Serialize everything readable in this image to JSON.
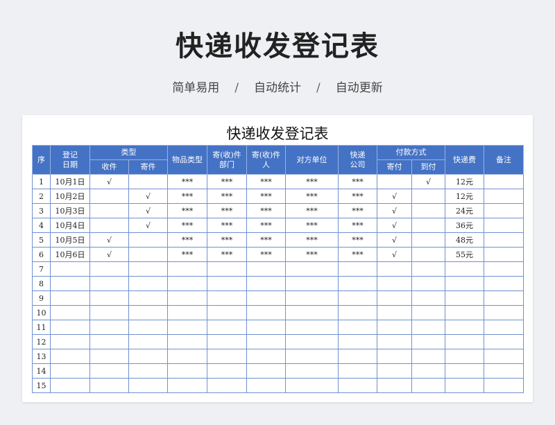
{
  "header": {
    "title": "快递收发登记表",
    "subtitle_items": [
      "简单易用",
      "自动统计",
      "自动更新"
    ],
    "separator": "/"
  },
  "sheet": {
    "title": "快递收发登记表",
    "columns": {
      "seq": "序",
      "date": "登记日期",
      "type_group": "类型",
      "receive": "收件",
      "send": "寄件",
      "item_type": "物品类型",
      "dept": "寄(收)件部门",
      "person": "寄(收)件人",
      "counterparty": "对方单位",
      "courier": "快递公司",
      "pay_group": "付款方式",
      "pay_send": "寄付",
      "pay_collect": "到付",
      "fee": "快递费",
      "note": "备注"
    },
    "rows": [
      {
        "seq": "1",
        "date": "10月1日",
        "receive": "√",
        "send": "",
        "item_type": "***",
        "dept": "***",
        "person": "***",
        "counterparty": "***",
        "courier": "***",
        "pay_send": "",
        "pay_collect": "√",
        "fee": "12元",
        "note": ""
      },
      {
        "seq": "2",
        "date": "10月2日",
        "receive": "",
        "send": "√",
        "item_type": "***",
        "dept": "***",
        "person": "***",
        "counterparty": "***",
        "courier": "***",
        "pay_send": "√",
        "pay_collect": "",
        "fee": "12元",
        "note": ""
      },
      {
        "seq": "3",
        "date": "10月3日",
        "receive": "",
        "send": "√",
        "item_type": "***",
        "dept": "***",
        "person": "***",
        "counterparty": "***",
        "courier": "***",
        "pay_send": "√",
        "pay_collect": "",
        "fee": "24元",
        "note": ""
      },
      {
        "seq": "4",
        "date": "10月4日",
        "receive": "",
        "send": "√",
        "item_type": "***",
        "dept": "***",
        "person": "***",
        "counterparty": "***",
        "courier": "***",
        "pay_send": "√",
        "pay_collect": "",
        "fee": "36元",
        "note": ""
      },
      {
        "seq": "5",
        "date": "10月5日",
        "receive": "√",
        "send": "",
        "item_type": "***",
        "dept": "***",
        "person": "***",
        "counterparty": "***",
        "courier": "***",
        "pay_send": "√",
        "pay_collect": "",
        "fee": "48元",
        "note": ""
      },
      {
        "seq": "6",
        "date": "10月6日",
        "receive": "√",
        "send": "",
        "item_type": "***",
        "dept": "***",
        "person": "***",
        "counterparty": "***",
        "courier": "***",
        "pay_send": "√",
        "pay_collect": "",
        "fee": "55元",
        "note": ""
      },
      {
        "seq": "7",
        "date": "",
        "receive": "",
        "send": "",
        "item_type": "",
        "dept": "",
        "person": "",
        "counterparty": "",
        "courier": "",
        "pay_send": "",
        "pay_collect": "",
        "fee": "",
        "note": ""
      },
      {
        "seq": "8",
        "date": "",
        "receive": "",
        "send": "",
        "item_type": "",
        "dept": "",
        "person": "",
        "counterparty": "",
        "courier": "",
        "pay_send": "",
        "pay_collect": "",
        "fee": "",
        "note": ""
      },
      {
        "seq": "9",
        "date": "",
        "receive": "",
        "send": "",
        "item_type": "",
        "dept": "",
        "person": "",
        "counterparty": "",
        "courier": "",
        "pay_send": "",
        "pay_collect": "",
        "fee": "",
        "note": ""
      },
      {
        "seq": "10",
        "date": "",
        "receive": "",
        "send": "",
        "item_type": "",
        "dept": "",
        "person": "",
        "counterparty": "",
        "courier": "",
        "pay_send": "",
        "pay_collect": "",
        "fee": "",
        "note": ""
      },
      {
        "seq": "11",
        "date": "",
        "receive": "",
        "send": "",
        "item_type": "",
        "dept": "",
        "person": "",
        "counterparty": "",
        "courier": "",
        "pay_send": "",
        "pay_collect": "",
        "fee": "",
        "note": ""
      },
      {
        "seq": "12",
        "date": "",
        "receive": "",
        "send": "",
        "item_type": "",
        "dept": "",
        "person": "",
        "counterparty": "",
        "courier": "",
        "pay_send": "",
        "pay_collect": "",
        "fee": "",
        "note": ""
      },
      {
        "seq": "13",
        "date": "",
        "receive": "",
        "send": "",
        "item_type": "",
        "dept": "",
        "person": "",
        "counterparty": "",
        "courier": "",
        "pay_send": "",
        "pay_collect": "",
        "fee": "",
        "note": ""
      },
      {
        "seq": "14",
        "date": "",
        "receive": "",
        "send": "",
        "item_type": "",
        "dept": "",
        "person": "",
        "counterparty": "",
        "courier": "",
        "pay_send": "",
        "pay_collect": "",
        "fee": "",
        "note": ""
      },
      {
        "seq": "15",
        "date": "",
        "receive": "",
        "send": "",
        "item_type": "",
        "dept": "",
        "person": "",
        "counterparty": "",
        "courier": "",
        "pay_send": "",
        "pay_collect": "",
        "fee": "",
        "note": ""
      }
    ]
  },
  "colors": {
    "header_bg": "#4472c4",
    "grid_line": "#6f90cf",
    "page_bg": "#eef0f3"
  }
}
